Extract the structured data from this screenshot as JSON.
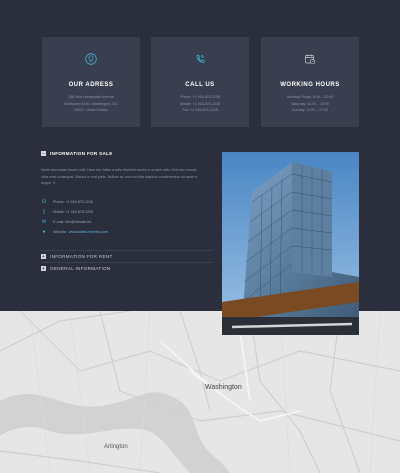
{
  "cards": [
    {
      "icon": "location-pin-icon",
      "title": "OUR ADRESS",
      "lines": [
        "168 New Hampshire Avenue",
        "Northwest #100, Washington, DC",
        "20037, United States"
      ]
    },
    {
      "icon": "phone-icon",
      "title": "CALL US",
      "lines": [
        "Phone: +1 916-875-2235",
        "Mobile: +1 916-875-2235",
        "Fax: +1 916-875-2235"
      ]
    },
    {
      "icon": "calendar-clock-icon",
      "title": "WORKING HOURS",
      "lines": [
        "Monday-Friday: 9:00 – 22:00",
        "Saturday: 11:00 – 18:00",
        "Sunday: 11:00 – 17:00"
      ]
    }
  ],
  "info": {
    "heading": "INFORMATION FOR SALE",
    "paragraph": "Morbi accumsan ipsum velit. Nam nec tellus a odio tincidunt auctor a ornare odio. Sed non mauris vitae erat consequat. Mauris in erat justo. Nullam ac urna eu felis dapibus condimentum sit amet a augue. S",
    "phone": "Phone: +1 916-875-2235",
    "mobile": "Mobile: +1 916-875-2235",
    "email": "E-mail: info@domain.tld",
    "website_label": "Website:",
    "website_link": "www.coded-themes.com"
  },
  "accordion": [
    "INFORMATION FOR RENT",
    "GENERAL INFORMATION"
  ],
  "map": {
    "city": "Washington",
    "sub": "Arlington"
  },
  "colors": {
    "accent": "#3fb3d4",
    "bg": "#2b2f3d",
    "card": "#3a3f50"
  }
}
